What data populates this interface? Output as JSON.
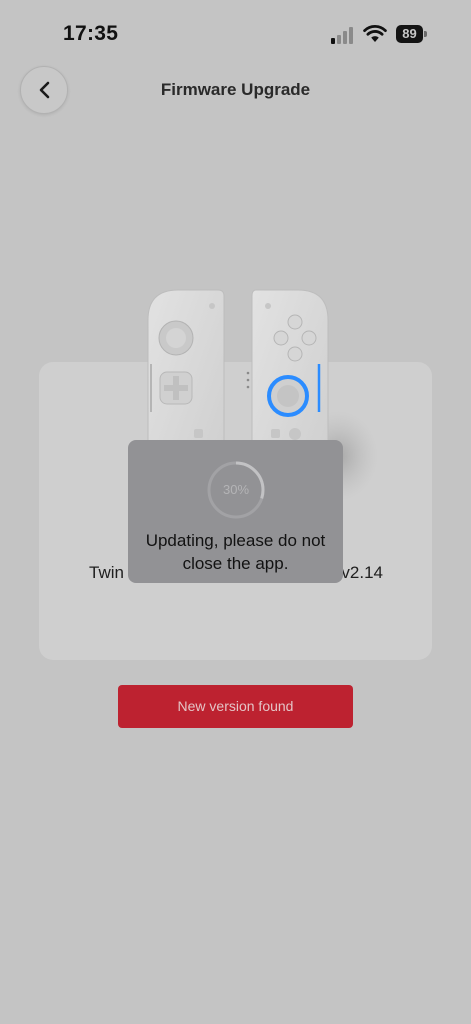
{
  "status_bar": {
    "time": "17:35",
    "battery_level": "89",
    "icons": [
      "signal-icon",
      "wifi-icon",
      "battery-icon"
    ]
  },
  "header": {
    "back_icon": "chevron-left-icon",
    "title": "Firmware Upgrade"
  },
  "device_card": {
    "image": "gamepad-controllers-image",
    "name_label": "Twin",
    "version_label": "v2.14"
  },
  "upgrade_button": {
    "label": "New version found",
    "color": "#bd2230"
  },
  "progress_dialog": {
    "percent_text": "30%",
    "progress": 0.3,
    "message": "Updating, please do not close the app."
  },
  "colors": {
    "background": "#c4c4c4",
    "card": "#cfcfcf",
    "accent_blue": "#2b8cff",
    "dialog": "#929295"
  }
}
